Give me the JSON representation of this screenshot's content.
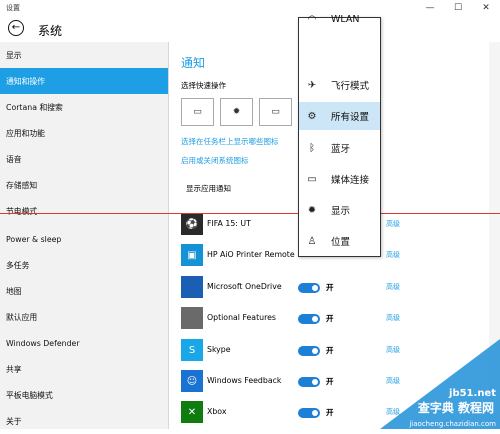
{
  "window": {
    "title": "设置",
    "minimize": "—",
    "maximize": "☐",
    "close": "✕"
  },
  "header": {
    "back_icon": "←",
    "title": "系统"
  },
  "sidebar": {
    "items": [
      {
        "label": "显示"
      },
      {
        "label": "通知和操作",
        "active": true
      },
      {
        "label": "Cortana 和搜索"
      },
      {
        "label": "应用和功能"
      },
      {
        "label": "语音"
      },
      {
        "label": "存储感知"
      },
      {
        "label": "节电模式"
      },
      {
        "label": "Power & sleep"
      },
      {
        "label": "多任务"
      },
      {
        "label": "地图"
      },
      {
        "label": "默认应用"
      },
      {
        "label": "Windows Defender"
      },
      {
        "label": "共享"
      },
      {
        "label": "平板电脑模式"
      },
      {
        "label": "关于"
      }
    ]
  },
  "main": {
    "section_title": "通知",
    "quick_actions_label": "选择快速操作",
    "quick_tiles": [
      {
        "icon": "tablet-icon",
        "glyph": "▭"
      },
      {
        "icon": "brightness-icon",
        "glyph": "✹"
      },
      {
        "icon": "project-icon",
        "glyph": "▭"
      },
      {
        "icon": "vpn-icon",
        "glyph": "⌁"
      }
    ],
    "link_taskbar_icons": "选择在任务栏上显示哪些图标",
    "link_system_icons": "启用或关闭系统图标",
    "show_notifications_label": "显示应用通知",
    "apps": [
      {
        "name": "FIFA 15: UT",
        "color": "#2a2a2a",
        "glyph": "⚽",
        "toggle": "",
        "adv": "高级"
      },
      {
        "name": "HP AiO Printer Remote",
        "color": "#1592d6",
        "glyph": "▣",
        "toggle": "",
        "adv": "高级"
      },
      {
        "name": "Microsoft OneDrive",
        "color": "#1a5fb4",
        "glyph": "",
        "toggle": "开",
        "adv": "高级"
      },
      {
        "name": "Optional Features",
        "color": "#6a6a6a",
        "glyph": "",
        "toggle": "开",
        "adv": "高级"
      },
      {
        "name": "Skype",
        "color": "#1aa7e8",
        "glyph": "S",
        "toggle": "开",
        "adv": "高级"
      },
      {
        "name": "Windows Feedback",
        "color": "#1a73d1",
        "glyph": "☺",
        "toggle": "开",
        "adv": "高级"
      },
      {
        "name": "Xbox",
        "color": "#107c10",
        "glyph": "✕",
        "toggle": "开",
        "adv": "高级"
      }
    ]
  },
  "popup": {
    "items": [
      {
        "icon": "wlan-icon",
        "glyph": "◠",
        "label": "WLAN"
      },
      {
        "icon": "airplane-icon",
        "glyph": "✈",
        "label": "飞行模式"
      },
      {
        "icon": "settings-icon",
        "glyph": "⚙",
        "label": "所有设置",
        "active": true
      },
      {
        "icon": "bluetooth-icon",
        "glyph": "ᛒ",
        "label": "蓝牙"
      },
      {
        "icon": "media-connect-icon",
        "glyph": "▭",
        "label": "媒体连接"
      },
      {
        "icon": "display-icon",
        "glyph": "✹",
        "label": "显示"
      },
      {
        "icon": "location-icon",
        "glyph": "♙",
        "label": "位置"
      }
    ]
  },
  "watermark": {
    "site": "jb51.net",
    "line1": "查字典 教程网",
    "line2": "jiaocheng.chazidian.com"
  },
  "colors": {
    "accent": "#1e9ee4",
    "divider_line": "#e0392b"
  }
}
